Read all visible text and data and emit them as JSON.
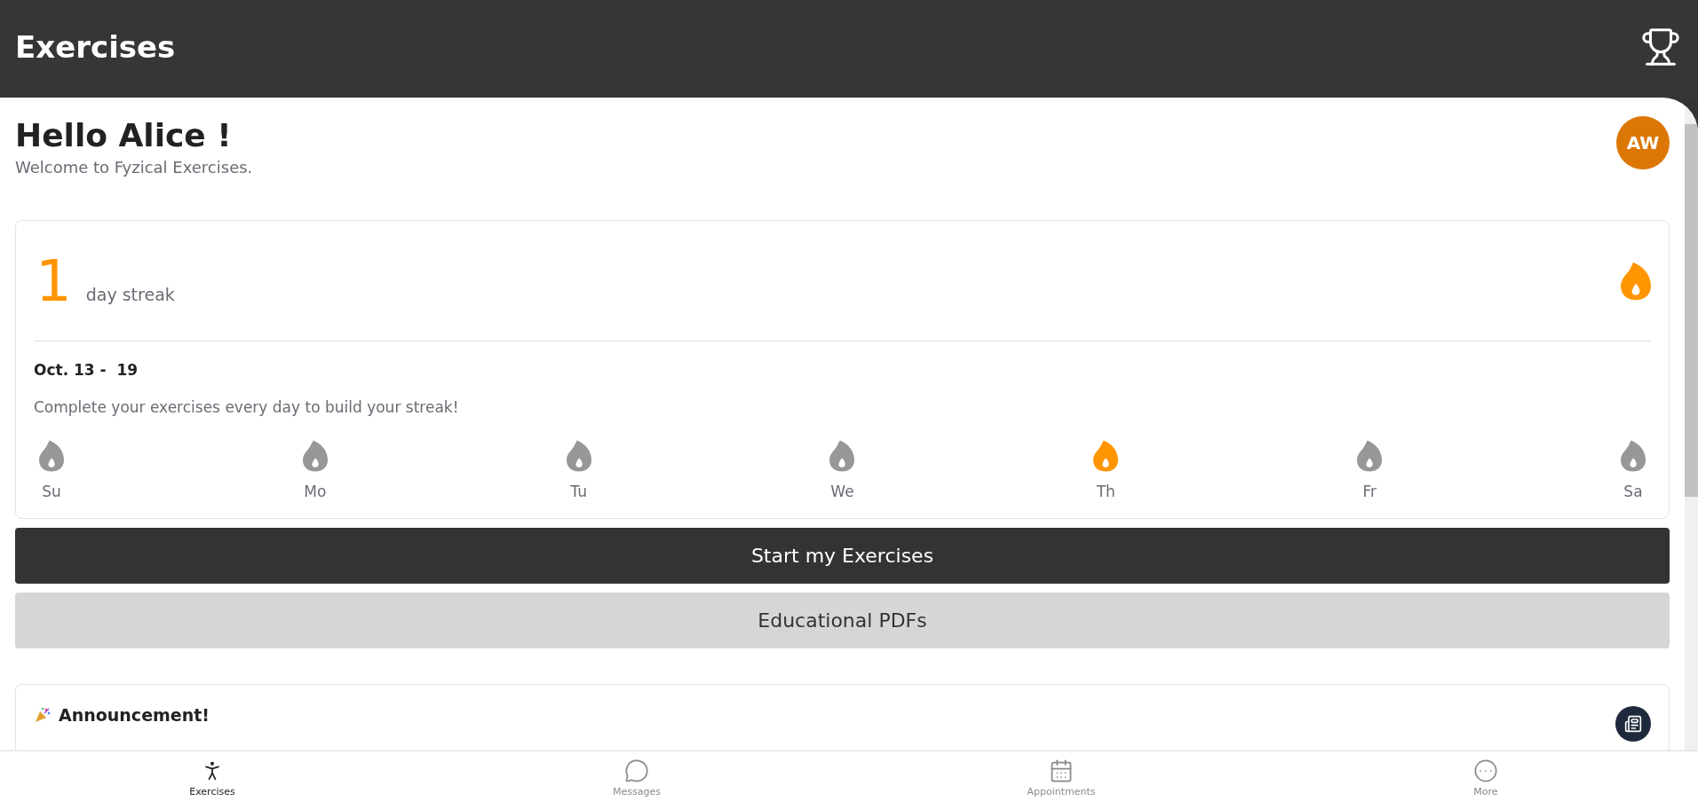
{
  "header": {
    "title": "Exercises"
  },
  "greeting": {
    "title": "Hello Alice !",
    "subtitle": "Welcome to Fyzical Exercises.",
    "avatar": "AW"
  },
  "streak": {
    "count": "1",
    "label": "day streak",
    "week": "Oct. 13 -  19",
    "hint": "Complete your exercises every day to build your streak!",
    "days": [
      {
        "label": "Su",
        "done": false
      },
      {
        "label": "Mo",
        "done": false
      },
      {
        "label": "Tu",
        "done": false
      },
      {
        "label": "We",
        "done": false
      },
      {
        "label": "Th",
        "done": true
      },
      {
        "label": "Fr",
        "done": false
      },
      {
        "label": "Sa",
        "done": false
      }
    ]
  },
  "buttons": [
    {
      "label": "Start my Exercises",
      "kind": "primary"
    },
    {
      "label": "Educational PDFs",
      "kind": "secondary"
    }
  ],
  "announcement": {
    "title": "Announcement!"
  },
  "nav": [
    {
      "label": "Exercises",
      "selected": true
    },
    {
      "label": "Messages",
      "selected": false
    },
    {
      "label": "Appointments",
      "selected": false
    },
    {
      "label": "More",
      "selected": false
    }
  ]
}
